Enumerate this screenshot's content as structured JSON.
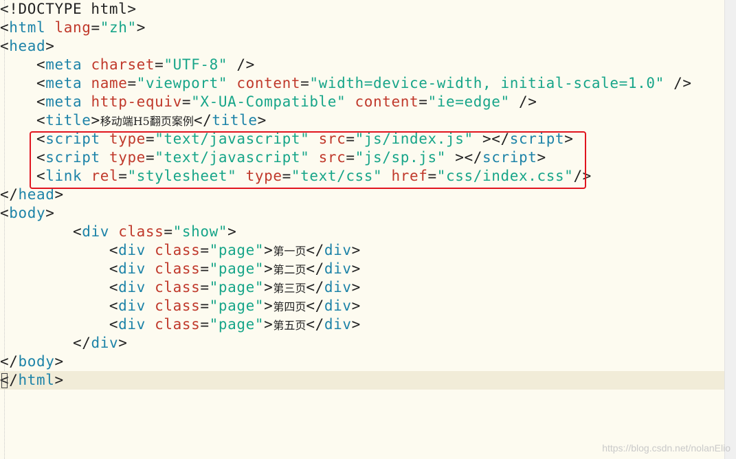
{
  "lines": [
    {
      "indent": "",
      "tokens": [
        [
          "p",
          "<!DOCTYPE html>"
        ]
      ]
    },
    {
      "indent": "",
      "tokens": [
        [
          "p",
          "<"
        ],
        [
          "t",
          "html"
        ],
        [
          "p",
          " "
        ],
        [
          "a",
          "lang"
        ],
        [
          "p",
          "="
        ],
        [
          "v",
          "\"zh\""
        ],
        [
          "p",
          ">"
        ]
      ]
    },
    {
      "indent": "",
      "tokens": [
        [
          "p",
          "<"
        ],
        [
          "t",
          "head"
        ],
        [
          "p",
          ">"
        ]
      ]
    },
    {
      "indent": "    ",
      "tokens": [
        [
          "p",
          "<"
        ],
        [
          "t",
          "meta"
        ],
        [
          "p",
          " "
        ],
        [
          "a",
          "charset"
        ],
        [
          "p",
          "="
        ],
        [
          "v",
          "\"UTF-8\""
        ],
        [
          "p",
          " />"
        ]
      ]
    },
    {
      "indent": "    ",
      "tokens": [
        [
          "p",
          "<"
        ],
        [
          "t",
          "meta"
        ],
        [
          "p",
          " "
        ],
        [
          "a",
          "name"
        ],
        [
          "p",
          "="
        ],
        [
          "v",
          "\"viewport\""
        ],
        [
          "p",
          " "
        ],
        [
          "a",
          "content"
        ],
        [
          "p",
          "="
        ],
        [
          "v",
          "\"width=device-width, initial-scale=1.0\""
        ],
        [
          "p",
          " />"
        ]
      ]
    },
    {
      "indent": "    ",
      "tokens": [
        [
          "p",
          "<"
        ],
        [
          "t",
          "meta"
        ],
        [
          "p",
          " "
        ],
        [
          "a",
          "http-equiv"
        ],
        [
          "p",
          "="
        ],
        [
          "v",
          "\"X-UA-Compatible\""
        ],
        [
          "p",
          " "
        ],
        [
          "a",
          "content"
        ],
        [
          "p",
          "="
        ],
        [
          "v",
          "\"ie=edge\""
        ],
        [
          "p",
          " />"
        ]
      ]
    },
    {
      "indent": "    ",
      "tokens": [
        [
          "p",
          "<"
        ],
        [
          "t",
          "title"
        ],
        [
          "p",
          ">"
        ],
        [
          "cn",
          "移动端H5翻页案例"
        ],
        [
          "p",
          "</"
        ],
        [
          "t",
          "title"
        ],
        [
          "p",
          ">"
        ]
      ]
    },
    {
      "indent": "    ",
      "tokens": [
        [
          "p",
          "<"
        ],
        [
          "t",
          "script"
        ],
        [
          "p",
          " "
        ],
        [
          "a",
          "type"
        ],
        [
          "p",
          "="
        ],
        [
          "v",
          "\"text/javascript\""
        ],
        [
          "p",
          " "
        ],
        [
          "a",
          "src"
        ],
        [
          "p",
          "="
        ],
        [
          "v",
          "\"js/index.js\""
        ],
        [
          "p",
          " ></"
        ],
        [
          "t",
          "script"
        ],
        [
          "p",
          ">"
        ]
      ]
    },
    {
      "indent": "    ",
      "tokens": [
        [
          "p",
          "<"
        ],
        [
          "t",
          "script"
        ],
        [
          "p",
          " "
        ],
        [
          "a",
          "type"
        ],
        [
          "p",
          "="
        ],
        [
          "v",
          "\"text/javascript\""
        ],
        [
          "p",
          " "
        ],
        [
          "a",
          "src"
        ],
        [
          "p",
          "="
        ],
        [
          "v",
          "\"js/sp.js\""
        ],
        [
          "p",
          " ></"
        ],
        [
          "t",
          "script"
        ],
        [
          "p",
          ">"
        ]
      ]
    },
    {
      "indent": "    ",
      "tokens": [
        [
          "p",
          "<"
        ],
        [
          "t",
          "link"
        ],
        [
          "p",
          " "
        ],
        [
          "a",
          "rel"
        ],
        [
          "p",
          "="
        ],
        [
          "v",
          "\"stylesheet\""
        ],
        [
          "p",
          " "
        ],
        [
          "a",
          "type"
        ],
        [
          "p",
          "="
        ],
        [
          "v",
          "\"text/css\""
        ],
        [
          "p",
          " "
        ],
        [
          "a",
          "href"
        ],
        [
          "p",
          "="
        ],
        [
          "v",
          "\"css/index.css\""
        ],
        [
          "p",
          "/>"
        ]
      ]
    },
    {
      "indent": "",
      "tokens": [
        [
          "p",
          "</"
        ],
        [
          "t",
          "head"
        ],
        [
          "p",
          ">"
        ]
      ]
    },
    {
      "indent": "",
      "tokens": [
        [
          "p",
          "<"
        ],
        [
          "t",
          "body"
        ],
        [
          "p",
          ">"
        ]
      ]
    },
    {
      "indent": "        ",
      "tokens": [
        [
          "p",
          "<"
        ],
        [
          "t",
          "div"
        ],
        [
          "p",
          " "
        ],
        [
          "a",
          "class"
        ],
        [
          "p",
          "="
        ],
        [
          "v",
          "\"show\""
        ],
        [
          "p",
          ">"
        ]
      ]
    },
    {
      "indent": "            ",
      "tokens": [
        [
          "p",
          "<"
        ],
        [
          "t",
          "div"
        ],
        [
          "p",
          " "
        ],
        [
          "a",
          "class"
        ],
        [
          "p",
          "="
        ],
        [
          "v",
          "\"page\""
        ],
        [
          "p",
          ">"
        ],
        [
          "cn",
          "第一页"
        ],
        [
          "p",
          "</"
        ],
        [
          "t",
          "div"
        ],
        [
          "p",
          ">"
        ]
      ]
    },
    {
      "indent": "            ",
      "tokens": [
        [
          "p",
          "<"
        ],
        [
          "t",
          "div"
        ],
        [
          "p",
          " "
        ],
        [
          "a",
          "class"
        ],
        [
          "p",
          "="
        ],
        [
          "v",
          "\"page\""
        ],
        [
          "p",
          ">"
        ],
        [
          "cn",
          "第二页"
        ],
        [
          "p",
          "</"
        ],
        [
          "t",
          "div"
        ],
        [
          "p",
          ">"
        ]
      ]
    },
    {
      "indent": "            ",
      "tokens": [
        [
          "p",
          "<"
        ],
        [
          "t",
          "div"
        ],
        [
          "p",
          " "
        ],
        [
          "a",
          "class"
        ],
        [
          "p",
          "="
        ],
        [
          "v",
          "\"page\""
        ],
        [
          "p",
          ">"
        ],
        [
          "cn",
          "第三页"
        ],
        [
          "p",
          "</"
        ],
        [
          "t",
          "div"
        ],
        [
          "p",
          ">"
        ]
      ]
    },
    {
      "indent": "            ",
      "tokens": [
        [
          "p",
          "<"
        ],
        [
          "t",
          "div"
        ],
        [
          "p",
          " "
        ],
        [
          "a",
          "class"
        ],
        [
          "p",
          "="
        ],
        [
          "v",
          "\"page\""
        ],
        [
          "p",
          ">"
        ],
        [
          "cn",
          "第四页"
        ],
        [
          "p",
          "</"
        ],
        [
          "t",
          "div"
        ],
        [
          "p",
          ">"
        ]
      ]
    },
    {
      "indent": "            ",
      "tokens": [
        [
          "p",
          "<"
        ],
        [
          "t",
          "div"
        ],
        [
          "p",
          " "
        ],
        [
          "a",
          "class"
        ],
        [
          "p",
          "="
        ],
        [
          "v",
          "\"page\""
        ],
        [
          "p",
          ">"
        ],
        [
          "cn",
          "第五页"
        ],
        [
          "p",
          "</"
        ],
        [
          "t",
          "div"
        ],
        [
          "p",
          ">"
        ]
      ]
    },
    {
      "indent": "        ",
      "tokens": [
        [
          "p",
          "</"
        ],
        [
          "t",
          "div"
        ],
        [
          "p",
          ">"
        ]
      ]
    },
    {
      "indent": "",
      "tokens": [
        [
          "p",
          "</"
        ],
        [
          "t",
          "body"
        ],
        [
          "p",
          ">"
        ]
      ]
    },
    {
      "indent": "",
      "tokens": [
        [
          "p",
          "</"
        ],
        [
          "t",
          "html"
        ],
        [
          "p",
          ">"
        ]
      ]
    }
  ],
  "current_line": 20,
  "highlighted_lines": [
    7,
    9
  ],
  "watermark": "https://blog.csdn.net/nolanElio",
  "colors": {
    "tag": "#1d83a8",
    "attribute": "#c0392b",
    "value": "#17a589",
    "highlight_box": "#e0141e",
    "background": "#fdfbf0",
    "current_line_bg": "#f1ecd8"
  }
}
